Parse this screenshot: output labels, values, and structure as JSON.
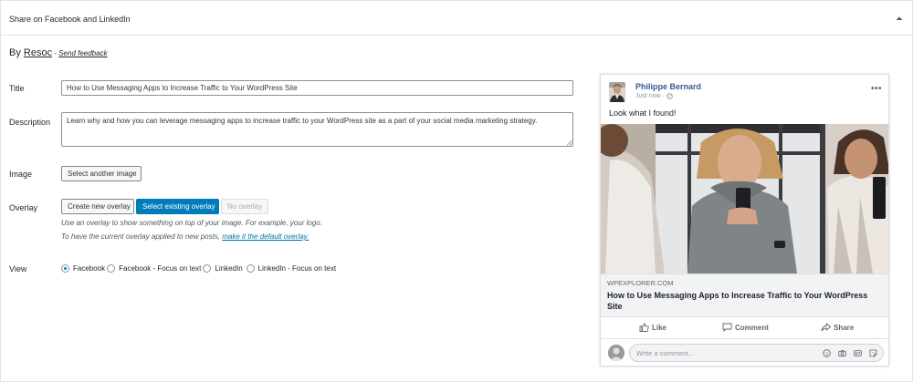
{
  "header": {
    "title": "Share on Facebook and LinkedIn"
  },
  "byline": {
    "by": "By",
    "brand": "Resoc",
    "separator": " - ",
    "feedback": "Send feedback"
  },
  "form": {
    "title_label": "Title",
    "title_value": "How to Use Messaging Apps to Increase Traffic to Your WordPress Site",
    "description_label": "Description",
    "description_value": "Learn why and how you can leverage messaging apps to increase traffic to your WordPress site as a part of your social media marketing strategy.",
    "image_label": "Image",
    "image_button": "Select another image",
    "overlay_label": "Overlay",
    "overlay_buttons": {
      "create": "Create new overlay",
      "select": "Select existing overlay",
      "none": "No overlay"
    },
    "overlay_help_1": "Use an overlay to show something on top of your image. For example, your logo.",
    "overlay_help_2": "To have the current overlay applied to new posts,",
    "overlay_help_link": "make it the default overlay.",
    "view_label": "View",
    "view_options": [
      "Facebook",
      "Facebook - Focus on text",
      "LinkedIn",
      "LinkedIn - Focus on text"
    ],
    "view_selected": "Facebook"
  },
  "preview": {
    "author": "Philippe Bernard",
    "time": "Just now",
    "dot": "·",
    "status": "Look what I found!",
    "more": "•••",
    "domain": "WPEXPLORER.COM",
    "headline": "How to Use Messaging Apps to Increase Traffic to Your WordPress Site",
    "actions": {
      "like": "Like",
      "comment": "Comment",
      "share": "Share"
    },
    "comment_placeholder": "Write a comment..."
  },
  "colors": {
    "wp_blue": "#007cba",
    "fb_blue": "#385898",
    "link": "#0073aa"
  }
}
